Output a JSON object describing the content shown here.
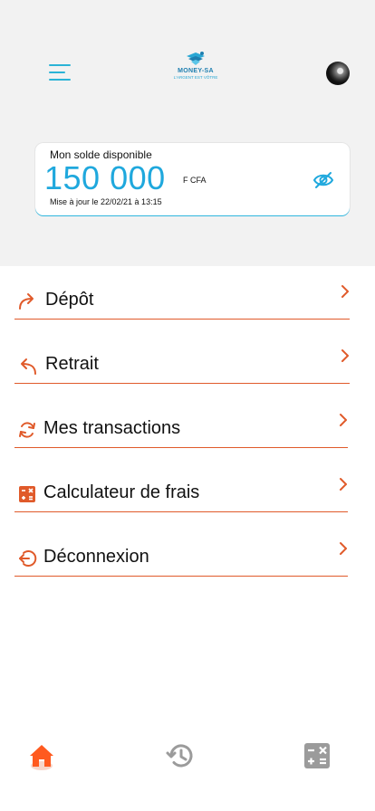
{
  "header": {
    "logo_name": "MONEY-SA",
    "logo_tagline": "L'ARGENT EST VÔTRE",
    "icons": {
      "menu": "hamburger-menu-icon",
      "profile": "avatar"
    }
  },
  "balance": {
    "title": "Mon solde disponible",
    "amount": "150 000",
    "currency": "F CFA",
    "updated": "Mise à jour le 22/02/21 à 13:15",
    "visibility_icon": "eye-slash-icon"
  },
  "menu": {
    "items": [
      {
        "label": "Dépôt",
        "icon": "forward-arrow-icon"
      },
      {
        "label": "Retrait",
        "icon": "undo-arrow-icon"
      },
      {
        "label": "Mes transactions",
        "icon": "refresh-icon"
      },
      {
        "label": "Calculateur de frais",
        "icon": "calculator-icon"
      },
      {
        "label": "Déconnexion",
        "icon": "logout-icon"
      }
    ]
  },
  "bottom_nav": {
    "items": [
      {
        "name": "home",
        "icon": "home-icon",
        "active": true
      },
      {
        "name": "history",
        "icon": "history-icon",
        "active": false
      },
      {
        "name": "calculator",
        "icon": "calculator-icon",
        "active": false
      }
    ]
  },
  "colors": {
    "accent_blue": "#1fa8dd",
    "accent_orange": "#e05a2a",
    "header_bg": "#f2f2f2",
    "nav_inactive": "#9b9b9b"
  }
}
